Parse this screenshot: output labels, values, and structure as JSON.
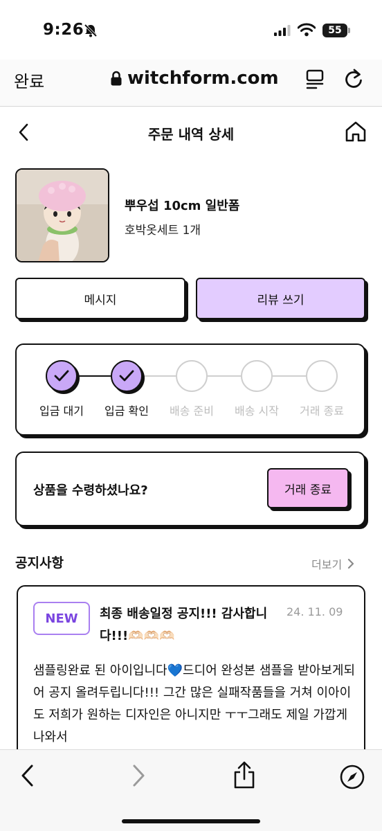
{
  "status_bar": {
    "time": "9:26",
    "battery": "55"
  },
  "browser": {
    "done_label": "완료",
    "url": "witchform.com"
  },
  "header": {
    "title": "주문 내역 상세"
  },
  "product": {
    "name": "뿌우섭 10cm 일반폼",
    "option": "호박옷세트 1개"
  },
  "actions": {
    "message_label": "메시지",
    "review_label": "리뷰 쓰기"
  },
  "progress": {
    "steps": [
      {
        "label": "입금 대기",
        "done": true
      },
      {
        "label": "입금 확인",
        "done": true
      },
      {
        "label": "배송 준비",
        "done": false
      },
      {
        "label": "배송 시작",
        "done": false
      },
      {
        "label": "거래 종료",
        "done": false
      }
    ]
  },
  "receive": {
    "question": "상품을 수령하셨나요?",
    "finish_label": "거래 종료"
  },
  "notice": {
    "section_title": "공지사항",
    "more_label": "더보기",
    "badge": "NEW",
    "headline": "최종 배송일정 공지!!! 감사합니다!!!🫶🏻🫶🏻🫶🏻",
    "date": "24. 11. 09",
    "body": "샘플링완료 된 아이입니다💙드디어  완성본 샘플을 받아보게되어 공지 올려두립니다!!! 그간 많은 실패작품들을 거쳐 이아이도 저희가 원하는 디자인은 아니지만 ㅜㅜ그래도 제일 가깝게 나와서"
  },
  "colors": {
    "accent_purple": "#c9a8f7",
    "review_button": "#e3ccff",
    "finish_button": "#f5b8f0",
    "badge_purple": "#7a45e0"
  }
}
